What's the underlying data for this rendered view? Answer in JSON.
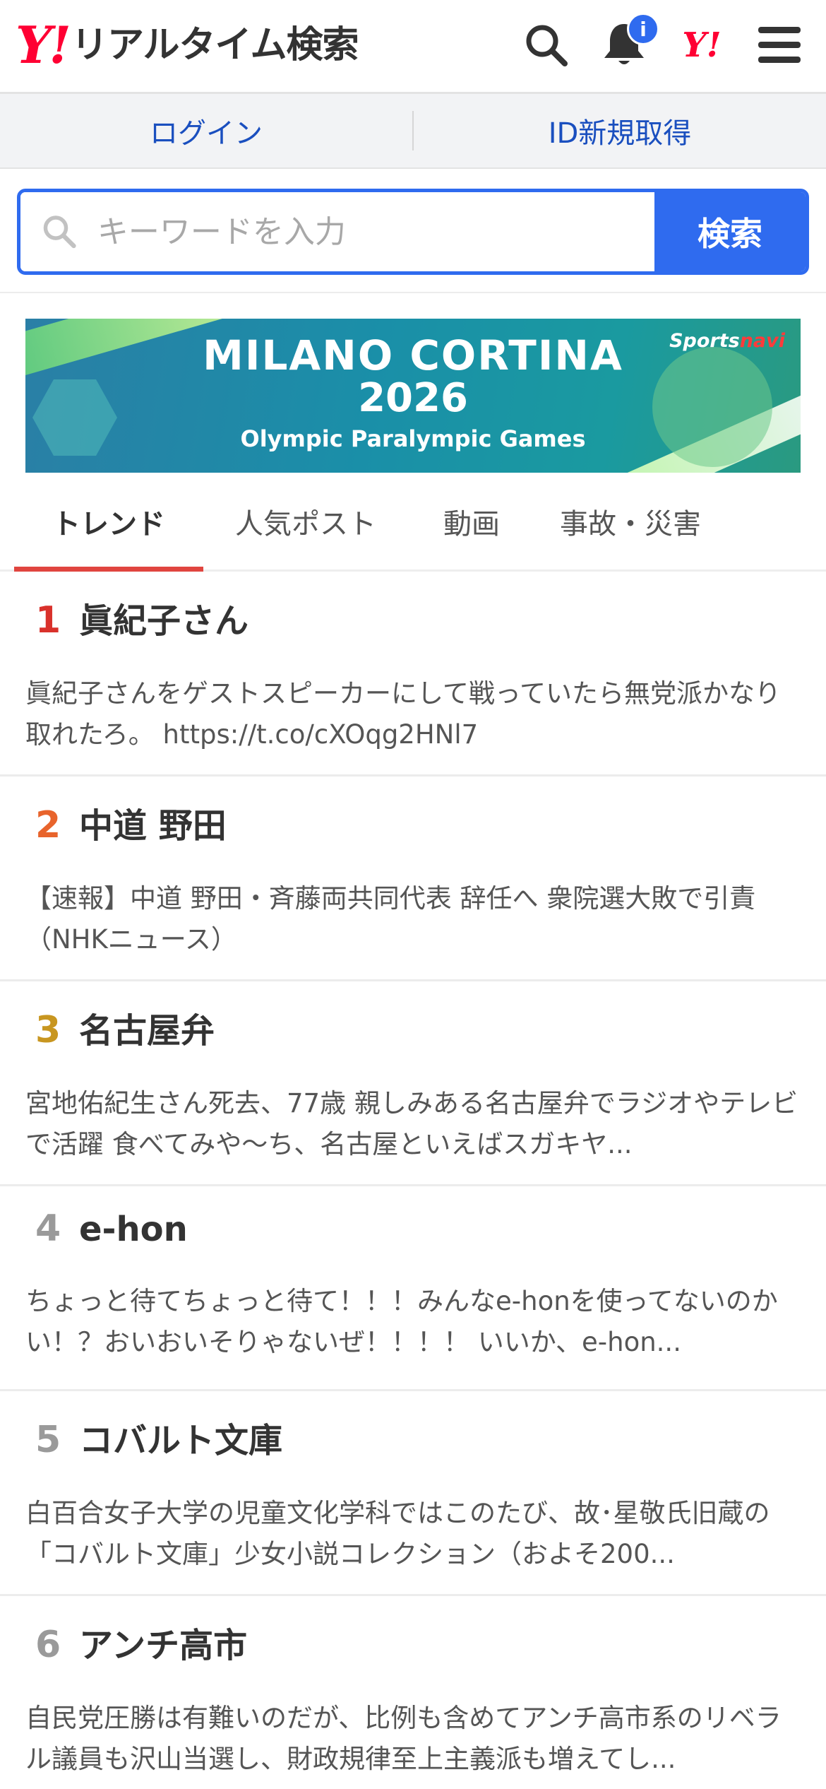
{
  "header": {
    "logo_mark": "Y!",
    "logo_text": "リアルタイム検索",
    "notification_badge": "i",
    "yj_mark": "Y!"
  },
  "login_bar": {
    "login_label": "ログイン",
    "signup_label": "ID新規取得"
  },
  "search": {
    "placeholder": "キーワードを入力",
    "button_label": "検索"
  },
  "banner": {
    "title": "MILANO CORTINA",
    "year": "2026",
    "subtitle": "Olympic Paralympic Games",
    "brand_a": "Sports",
    "brand_b": "navi"
  },
  "tabs": [
    {
      "label": "トレンド",
      "active": true
    },
    {
      "label": "人気ポスト",
      "active": false
    },
    {
      "label": "動画",
      "active": false
    },
    {
      "label": "事故・災害",
      "active": false
    }
  ],
  "trends": [
    {
      "rank": "1",
      "title": "眞紀子さん",
      "desc": "眞紀子さんをゲストスピーカーにして戦っていたら無党派かなり取れたろ。 https://t.co/cXOqg2HNl7",
      "color": "#d9312b"
    },
    {
      "rank": "2",
      "title": "中道 野田",
      "desc": "【速報】中道 野田・斉藤両共同代表 辞任へ 衆院選大敗で引責 （NHKニュース）",
      "color": "#e8642c"
    },
    {
      "rank": "3",
      "title": "名古屋弁",
      "desc": "宮地佑紀生さん死去、77歳 親しみある名古屋弁でラジオやテレビで活躍 食べてみや〜ち、名古屋といえばスガキヤ...",
      "color": "#c89620"
    },
    {
      "rank": "4",
      "title": "e-hon",
      "desc": "ちょっと待てちょっと待て！！！みんなe-honを使ってないのかい！？おいおいそりゃないぜ！！！！ いいか、e-hon...",
      "color": "#9a9a9a"
    },
    {
      "rank": "5",
      "title": "コバルト文庫",
      "desc": "白百合女子大学の児童文化学科ではこのたび、故･星敬氏旧蔵の「コバルト文庫」少女小説コレクション（およそ200...",
      "color": "#9a9a9a"
    },
    {
      "rank": "6",
      "title": "アンチ高市",
      "desc": "自民党圧勝は有難いのだが、比例も含めてアンチ高市系のリベラル議員も沢山当選し、財政規律至上主義派も増えてし...",
      "color": "#9a9a9a"
    }
  ]
}
